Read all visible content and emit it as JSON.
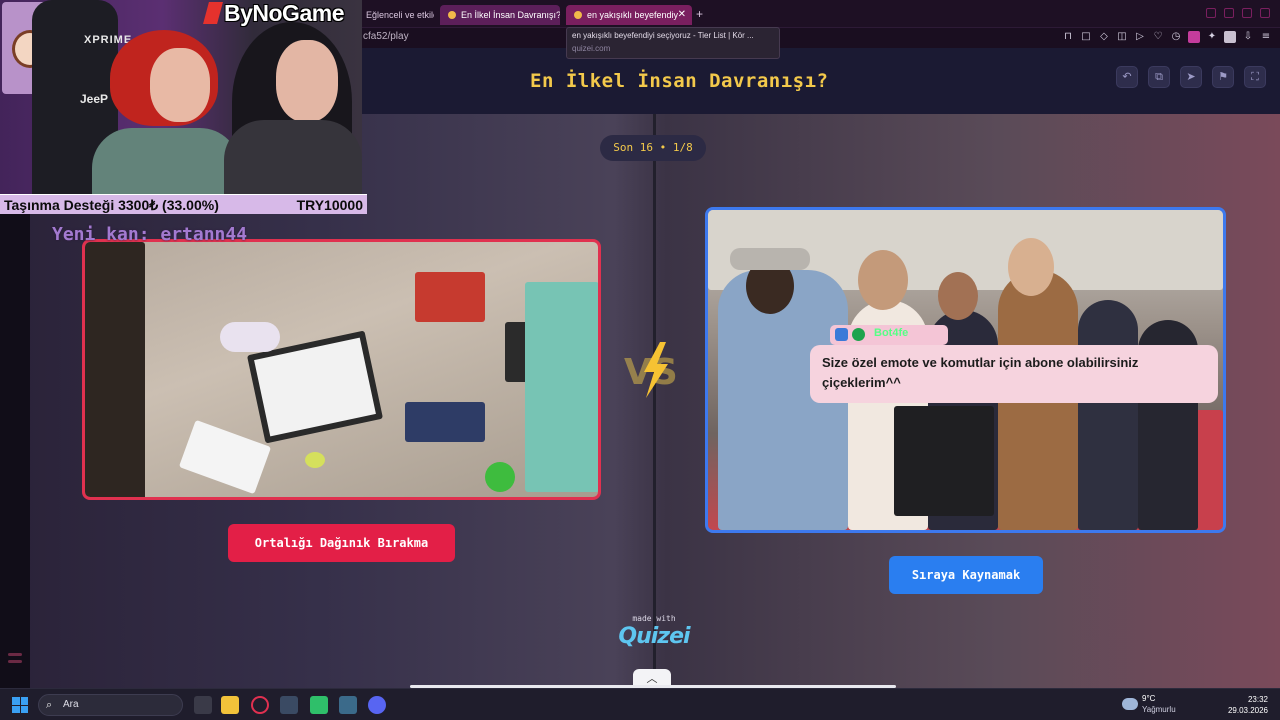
{
  "browser": {
    "tabs": [
      {
        "label": "Eğlenceli ve etkile"
      },
      {
        "label": "En İlkel İnsan Davranışı? -"
      },
      {
        "label": "en yakışıklı beyefendiy"
      }
    ],
    "new_tab": "+",
    "url": "cfa52/play",
    "tooltip_title": "en yakışıklı beyefendiyi seçiyoruz - Tier List | Kör ...",
    "tooltip_domain": "quizei.com"
  },
  "app": {
    "title": "En İlkel İnsan Davranışı?",
    "round_badge": "Son 16 • 1/8",
    "left_choice": "Ortalığı Dağınık Bırakma",
    "right_choice": "Sıraya Kaynamak",
    "vs": "VS",
    "made_with": "made with",
    "brand": "Quizei",
    "header_icons": [
      "undo-icon",
      "share-icon",
      "send-icon",
      "flag-icon",
      "fullscreen-icon"
    ]
  },
  "stream": {
    "channel": "ByNoGame",
    "chair_brand": "XPRIME",
    "chair_text": "JeeP",
    "donation_left": "Taşınma Desteği 3300₺ (33.00%)",
    "donation_right": "TRY10000",
    "sub_alert": "Yeni kan: ertann44",
    "chat_user": "Bot4fe",
    "chat_message": "Size özel emote ve komutlar için abone olabilirsiniz çiçeklerim^^"
  },
  "taskbar": {
    "search_placeholder": "Ara",
    "weather_temp": "9°C",
    "weather_cond": "Yağmurlu",
    "time": "23:32",
    "date": "29.03.2026"
  },
  "colors": {
    "title": "#f3c94b",
    "left_accent": "#e31f47",
    "right_accent": "#2a7ef0",
    "chat_name": "#57ff86"
  }
}
